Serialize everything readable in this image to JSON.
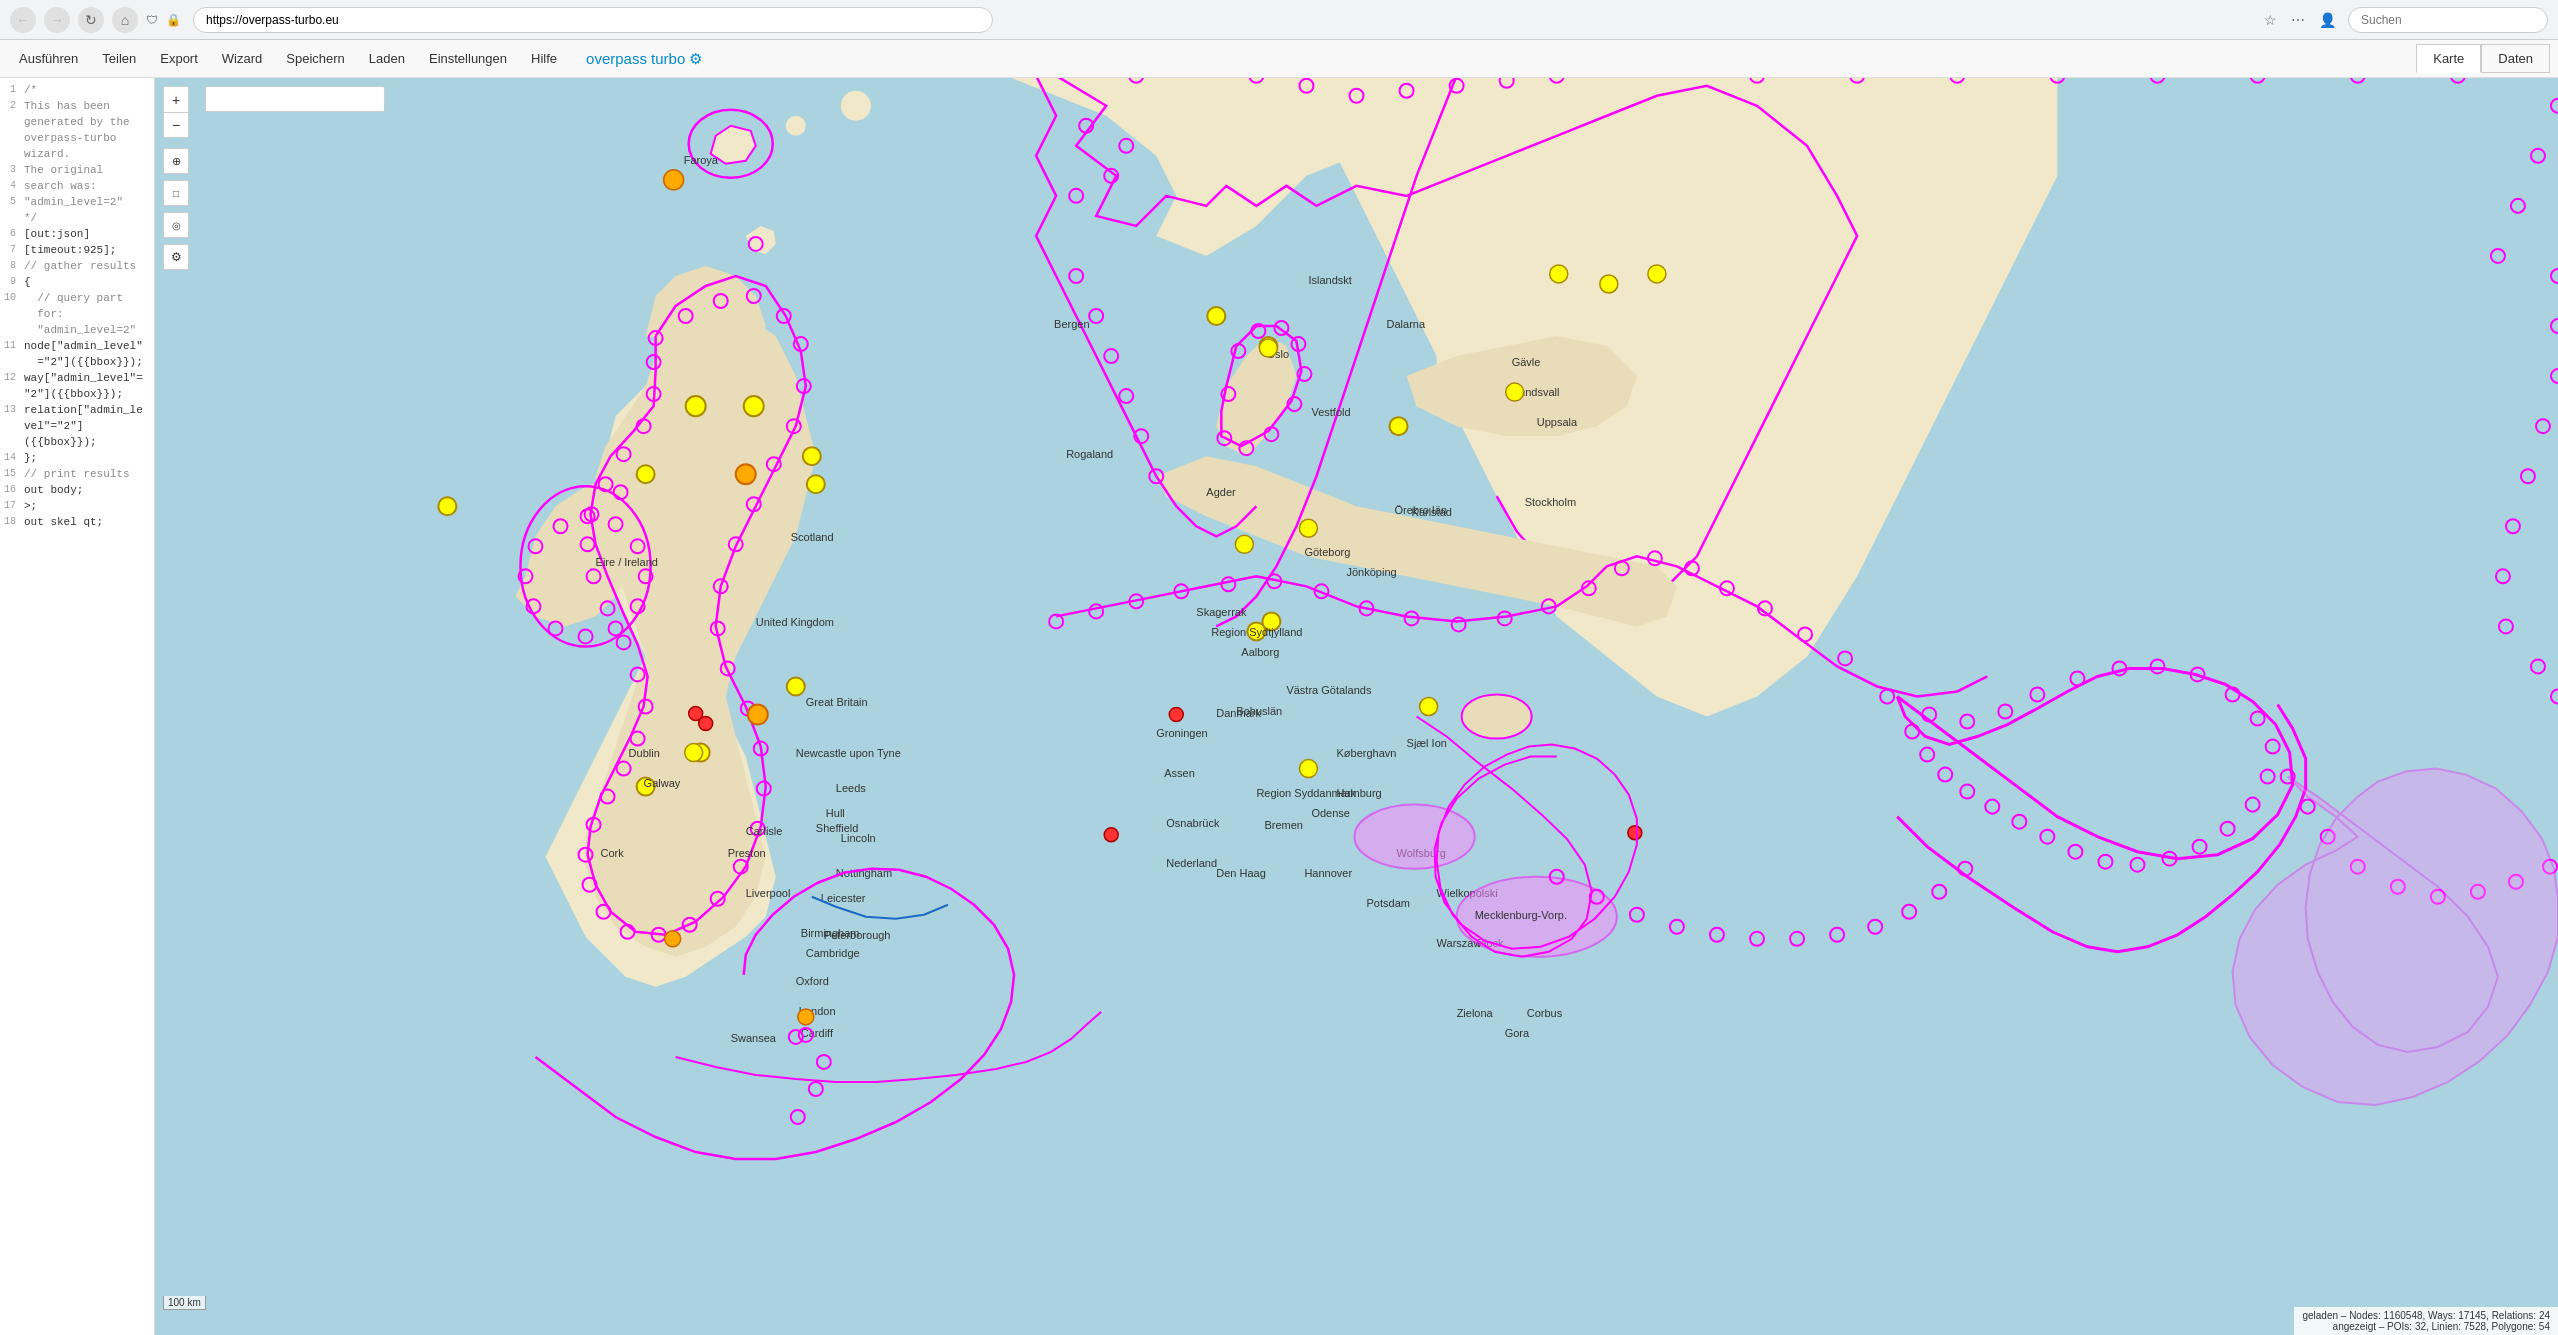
{
  "browser": {
    "url": "https://overpass-turbo.eu",
    "search_placeholder": "Suchen"
  },
  "toolbar": {
    "buttons": [
      "Ausführen",
      "Teilen",
      "Export",
      "Wizard",
      "Speichern",
      "Laden",
      "Einstellungen",
      "Hilfe"
    ],
    "title": "overpass turbo",
    "tab_map": "Karte",
    "tab_data": "Daten"
  },
  "code_editor": {
    "lines": [
      {
        "num": 1,
        "text": "/*",
        "type": "comment"
      },
      {
        "num": 2,
        "text": "This has been",
        "type": "comment"
      },
      {
        "num": 3,
        "text": "generated by the",
        "type": "comment"
      },
      {
        "num": "",
        "text": "overpass-turbo",
        "type": "comment"
      },
      {
        "num": "",
        "text": "wizard.",
        "type": "comment"
      },
      {
        "num": 3,
        "text": "The original",
        "type": "comment"
      },
      {
        "num": 4,
        "text": "search was:",
        "type": "comment"
      },
      {
        "num": 5,
        "text": "\"admin_level=2\"",
        "type": "comment"
      },
      {
        "num": "",
        "text": "*/",
        "type": "comment"
      },
      {
        "num": 6,
        "text": "[out:json]",
        "type": "normal"
      },
      {
        "num": 7,
        "text": "[timeout:925];",
        "type": "normal"
      },
      {
        "num": 8,
        "text": "// gather results",
        "type": "comment"
      },
      {
        "num": 9,
        "text": "{",
        "type": "normal"
      },
      {
        "num": 10,
        "text": "  // query part",
        "type": "comment"
      },
      {
        "num": "",
        "text": "  for:",
        "type": "comment"
      },
      {
        "num": "",
        "text": "  \"admin_level=2\"",
        "type": "comment"
      },
      {
        "num": 11,
        "text": "node[\"admin_level\"",
        "type": "normal"
      },
      {
        "num": "",
        "text": "  =\"2\"]({{bbox}});",
        "type": "normal"
      },
      {
        "num": 12,
        "text": "way[\"admin_level\"=",
        "type": "normal"
      },
      {
        "num": "",
        "text": "\"2\"]({{bbox}});",
        "type": "normal"
      },
      {
        "num": 13,
        "text": "relation[\"admin_le",
        "type": "normal"
      },
      {
        "num": "",
        "text": "vel\"=\"2\"]",
        "type": "normal"
      },
      {
        "num": "",
        "text": "({{bbox}});",
        "type": "normal"
      },
      {
        "num": 14,
        "text": "};",
        "type": "normal"
      },
      {
        "num": 15,
        "text": "// print results",
        "type": "comment"
      },
      {
        "num": 16,
        "text": "out body;",
        "type": "normal"
      },
      {
        "num": 17,
        "text": ">;",
        "type": "normal"
      },
      {
        "num": 18,
        "text": "out skel qt;",
        "type": "normal"
      }
    ]
  },
  "map": {
    "search_placeholder": "",
    "scale": "100 km",
    "status": "geladen – Nodes: 1160548, Ways: 17145, Relations: 24\nangezeigt – POIs: 32, Linien: 7528, Polygone: 54"
  },
  "map_controls": {
    "zoom_in": "+",
    "zoom_out": "−",
    "locate": "⊕",
    "query_bounds": "□",
    "compass": "◎",
    "settings": "⚙"
  }
}
